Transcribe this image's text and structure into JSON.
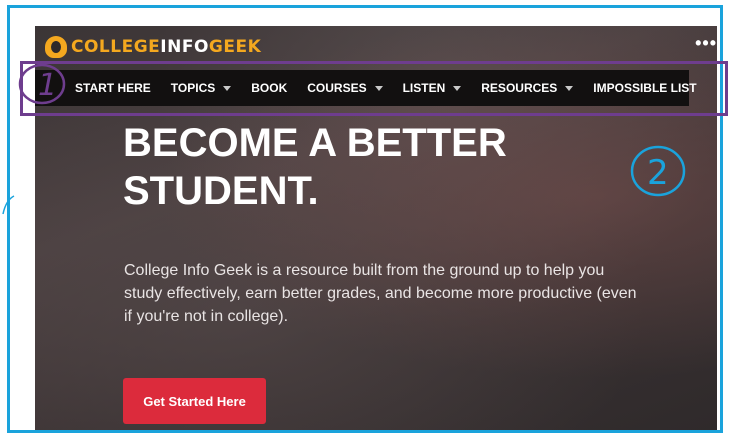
{
  "logo": {
    "part1": "COLLEGE",
    "part2": "INFO",
    "part3": "GEEK"
  },
  "menu_dots": "•••",
  "nav": {
    "items": [
      {
        "label": "START HERE",
        "dropdown": false
      },
      {
        "label": "TOPICS",
        "dropdown": true
      },
      {
        "label": "BOOK",
        "dropdown": false
      },
      {
        "label": "COURSES",
        "dropdown": true
      },
      {
        "label": "LISTEN",
        "dropdown": true
      },
      {
        "label": "RESOURCES",
        "dropdown": true
      },
      {
        "label": "IMPOSSIBLE LIST",
        "dropdown": false
      }
    ]
  },
  "hero": {
    "headline_line1": "BECOME A BETTER",
    "headline_line2": "STUDENT.",
    "subtext": "College Info Geek is a resource built from the ground up to help you study effectively, earn better grades, and become more productive (even if you're not in college).",
    "cta_label": "Get Started Here"
  },
  "annotations": {
    "marker1": "1",
    "marker2": "2"
  },
  "colors": {
    "accent_orange": "#f4a81f",
    "cta_red": "#dc2b3c",
    "annotation_purple": "#6e3d8e",
    "annotation_blue": "#1aa3dc"
  }
}
